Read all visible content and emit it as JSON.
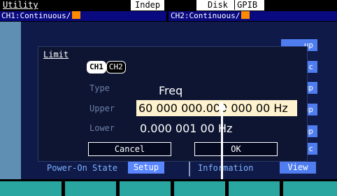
{
  "status": {
    "utility": "Utility",
    "mode": "Indep",
    "disk": "Disk",
    "gpib": "GPIB",
    "ch1": "CH1:Continuous/",
    "ch2": "CH2:Continuous/"
  },
  "background": {
    "power_on_label": "Power-On State",
    "setup_button": "Setup",
    "information_label": "Information",
    "view_button": "View",
    "right_buttons": [
      "up",
      "c",
      "up",
      "up",
      "up",
      "c"
    ]
  },
  "dialog": {
    "title": "Limit",
    "channel_tabs": [
      "CH1",
      "CH2"
    ],
    "selected_channel": "CH1",
    "type_label": "Type",
    "type_value": "Freq",
    "upper_label": "Upper",
    "upper_value": "60 000 000.000 000 00 Hz",
    "lower_label": "Lower",
    "lower_value": "0.000 001 00 Hz",
    "cancel_button": "Cancel",
    "ok_button": "OK"
  },
  "colors": {
    "accent_orange": "#ff8a00",
    "button_blue": "#4f7df0",
    "softkey_teal": "#2aa6a0",
    "value_field": "#fff3cf"
  },
  "icons": [
    "arrow-up-icon"
  ]
}
